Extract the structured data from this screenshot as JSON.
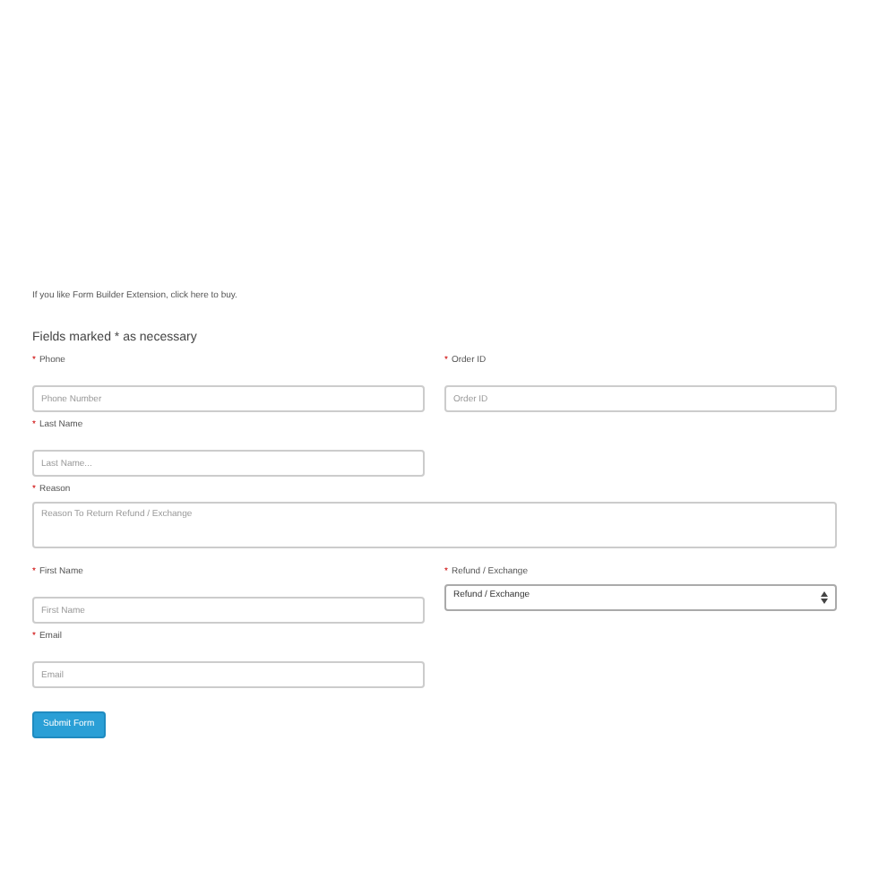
{
  "intro": "If you like Form Builder Extension, click here to buy.",
  "heading": "Fields marked * as necessary",
  "rows": [
    [
      {
        "kind": "input",
        "marker": "*",
        "label": "Phone",
        "placeholder": "Phone Number"
      },
      {
        "kind": "input",
        "marker": "*",
        "label": "Order ID",
        "placeholder": "Order ID"
      }
    ],
    [
      {
        "kind": "input",
        "marker": "*",
        "label": "Last Name",
        "placeholder": "Last Name..."
      }
    ],
    [
      {
        "kind": "textarea",
        "marker": "*",
        "label": "Reason",
        "placeholder": "Reason To Return Refund / Exchange"
      }
    ],
    [
      {
        "kind": "input",
        "marker": "*",
        "label": "First Name",
        "placeholder": "First Name"
      },
      {
        "kind": "select",
        "marker": "*",
        "label": "Refund / Exchange",
        "value": "Refund / Exchange"
      }
    ],
    [
      {
        "kind": "input",
        "marker": "*",
        "label": "Email",
        "placeholder": "Email"
      }
    ]
  ],
  "submit": "Submit Form"
}
